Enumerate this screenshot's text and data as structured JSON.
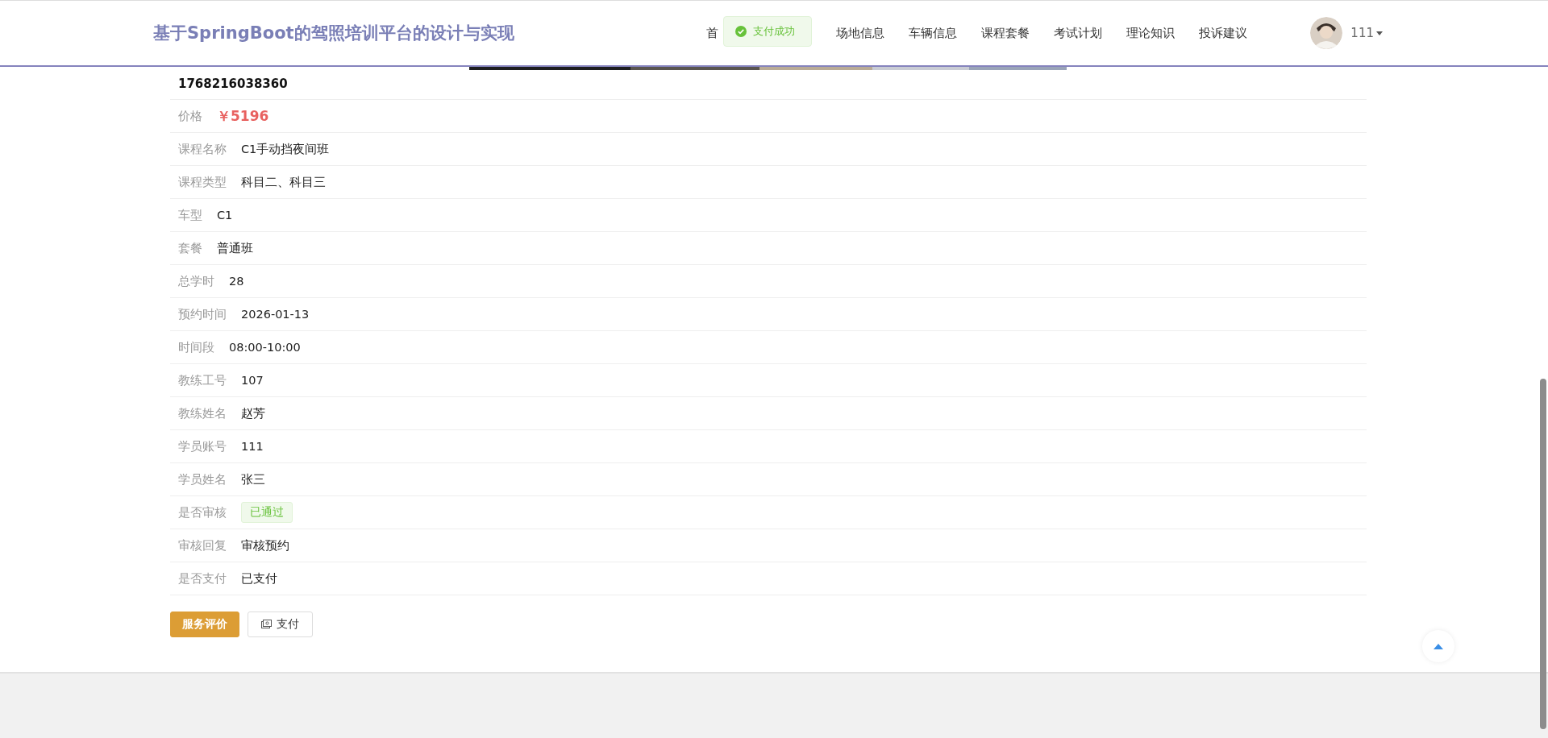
{
  "header": {
    "title": "基于SpringBoot的驾照培训平台的设计与实现",
    "nav": [
      {
        "label": "首"
      },
      {
        "label": "场地信息"
      },
      {
        "label": "车辆信息"
      },
      {
        "label": "课程套餐"
      },
      {
        "label": "考试计划"
      },
      {
        "label": "理论知识"
      },
      {
        "label": "投诉建议"
      }
    ],
    "user": {
      "name": "111"
    }
  },
  "toast": {
    "kind": "success",
    "text": "支付成功"
  },
  "order_number": "1768216038360",
  "fields": [
    {
      "kind": "price",
      "label": "价格",
      "value": "￥5196"
    },
    {
      "kind": "text",
      "label": "课程名称",
      "value": "C1手动挡夜间班"
    },
    {
      "kind": "text",
      "label": "课程类型",
      "value": "科目二、科目三"
    },
    {
      "kind": "text",
      "label": "车型",
      "value": "C1"
    },
    {
      "kind": "text",
      "label": "套餐",
      "value": "普通班"
    },
    {
      "kind": "text",
      "label": "总学时",
      "value": "28"
    },
    {
      "kind": "text",
      "label": "预约时间",
      "value": "2026-01-13"
    },
    {
      "kind": "text",
      "label": "时间段",
      "value": "08:00-10:00"
    },
    {
      "kind": "text",
      "label": "教练工号",
      "value": "107"
    },
    {
      "kind": "text",
      "label": "教练姓名",
      "value": "赵芳"
    },
    {
      "kind": "text",
      "label": "学员账号",
      "value": "111"
    },
    {
      "kind": "text",
      "label": "学员姓名",
      "value": "张三"
    },
    {
      "kind": "tag",
      "label": "是否审核",
      "value": "已通过"
    },
    {
      "kind": "text",
      "label": "审核回复",
      "value": "审核预约"
    },
    {
      "kind": "text",
      "label": "是否支付",
      "value": "已支付"
    }
  ],
  "buttons": [
    {
      "kind": "primary",
      "label": "服务评价"
    },
    {
      "kind": "pay",
      "label": "支付"
    }
  ]
}
